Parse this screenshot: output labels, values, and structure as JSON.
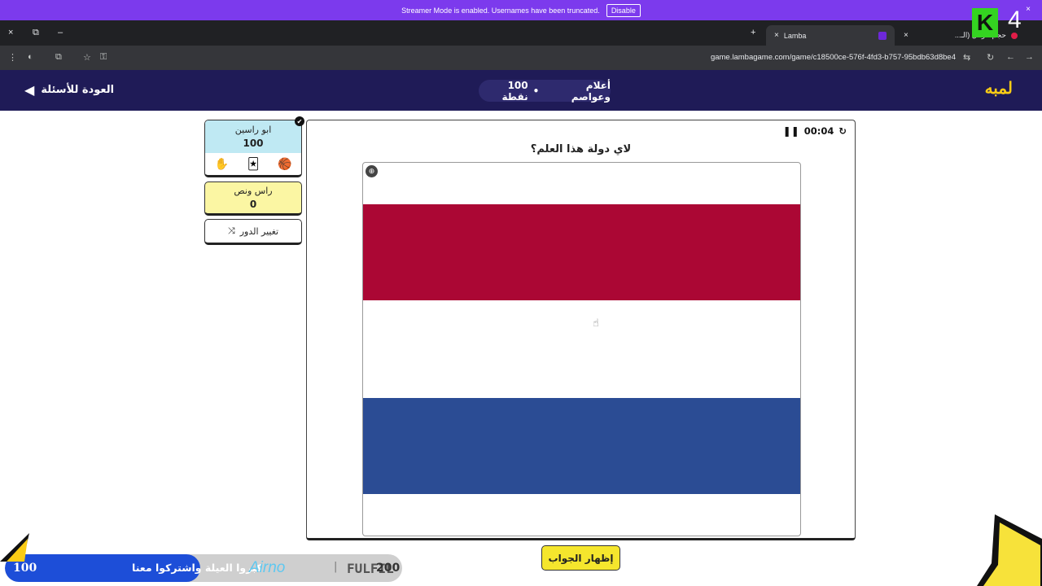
{
  "banner": {
    "message": "Streamer Mode is enabled. Usernames have been truncated.",
    "disable_label": "Disable",
    "close": "×"
  },
  "browser": {
    "tabs": [
      {
        "title": "Lamba",
        "close": "×"
      },
      {
        "title": "حجم الزعل (الـ...",
        "close": "×"
      }
    ],
    "new_tab": "+",
    "window_close": "×",
    "window_restore": "⧉",
    "window_min": "–",
    "url": "game.lambagame.com/game/c18500ce-576f-4fd3-b757-95bdb63d8be4"
  },
  "header": {
    "back_label": "العودة للأسئلة",
    "category": "أعلام وعواصم",
    "points": "100 نقطة",
    "bullet": "•",
    "logo": "لمبه"
  },
  "teams": [
    {
      "name": "ابو راسين",
      "score": "100",
      "active": true
    },
    {
      "name": "راس ونص",
      "score": "0",
      "active": false
    }
  ],
  "team_tools": [
    {
      "name": "hand-icon",
      "glyph": "✋"
    },
    {
      "name": "cards-icon",
      "glyph": "🃏"
    },
    {
      "name": "ball-icon",
      "glyph": "🏀"
    }
  ],
  "turn_button": {
    "label": "تغيير الدور",
    "icon": "⤨"
  },
  "question": {
    "timer": "00:04",
    "pause_icon": "❚❚",
    "reset_icon": "↻",
    "text": "لاي دولة هذا العلم؟",
    "expand_icon": "⊕",
    "flag": {
      "colors": [
        "#ab0734",
        "#ffffff",
        "#2b4c94"
      ]
    },
    "reveal_label": "إظهار الجواب"
  },
  "overlay": {
    "ticker_number": "100",
    "ticker_message": "كبروا العيلة واشتركوا معنا",
    "brand1": "Airno",
    "separator": "|",
    "brand2": "FULFIL",
    "brand2_value": "200",
    "badge_letter": "K",
    "badge_number": "4"
  }
}
